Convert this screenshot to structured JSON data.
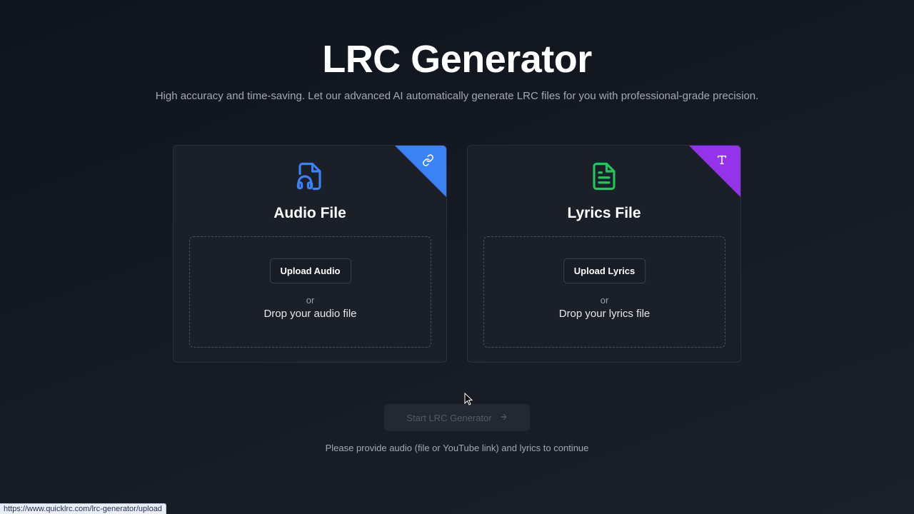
{
  "page": {
    "title": "LRC Generator",
    "subtitle": "High accuracy and time-saving. Let our advanced AI automatically generate LRC files for you with professional-grade precision."
  },
  "cards": {
    "audio": {
      "title": "Audio File",
      "upload_label": "Upload Audio",
      "or": "or",
      "drop_text": "Drop your audio file",
      "icon": "audio-file-icon",
      "corner_icon": "link-icon",
      "accent": "#3b82f6"
    },
    "lyrics": {
      "title": "Lyrics File",
      "upload_label": "Upload Lyrics",
      "or": "or",
      "drop_text": "Drop your lyrics file",
      "icon": "lyrics-file-icon",
      "corner_icon": "text-icon",
      "accent": "#9333ea"
    }
  },
  "actions": {
    "start_label": "Start LRC Generator",
    "start_icon": "arrow-right-icon",
    "hint": "Please provide audio (file or YouTube link) and lyrics to continue"
  },
  "status_bar": {
    "url": "https://www.quicklrc.com/lrc-generator/upload"
  },
  "colors": {
    "audio_icon": "#3b82f6",
    "lyrics_icon": "#22c55e"
  }
}
